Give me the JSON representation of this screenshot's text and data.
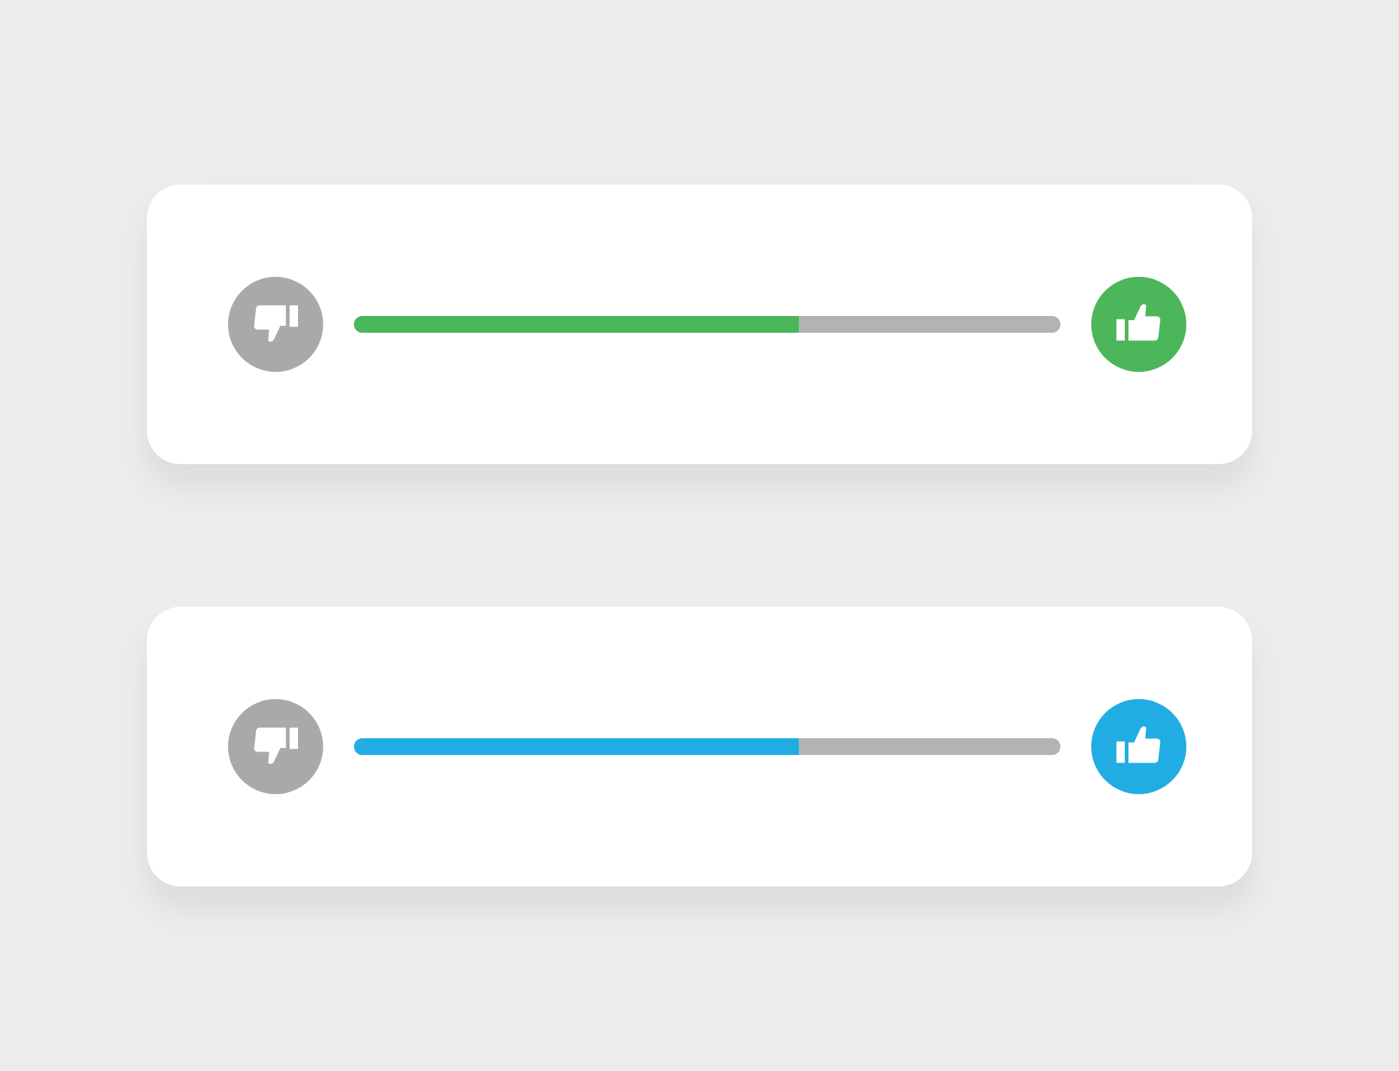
{
  "ratings": [
    {
      "level": 0.63,
      "color": "#4cb65a"
    },
    {
      "level": 0.63,
      "color": "#21ade4"
    }
  ]
}
